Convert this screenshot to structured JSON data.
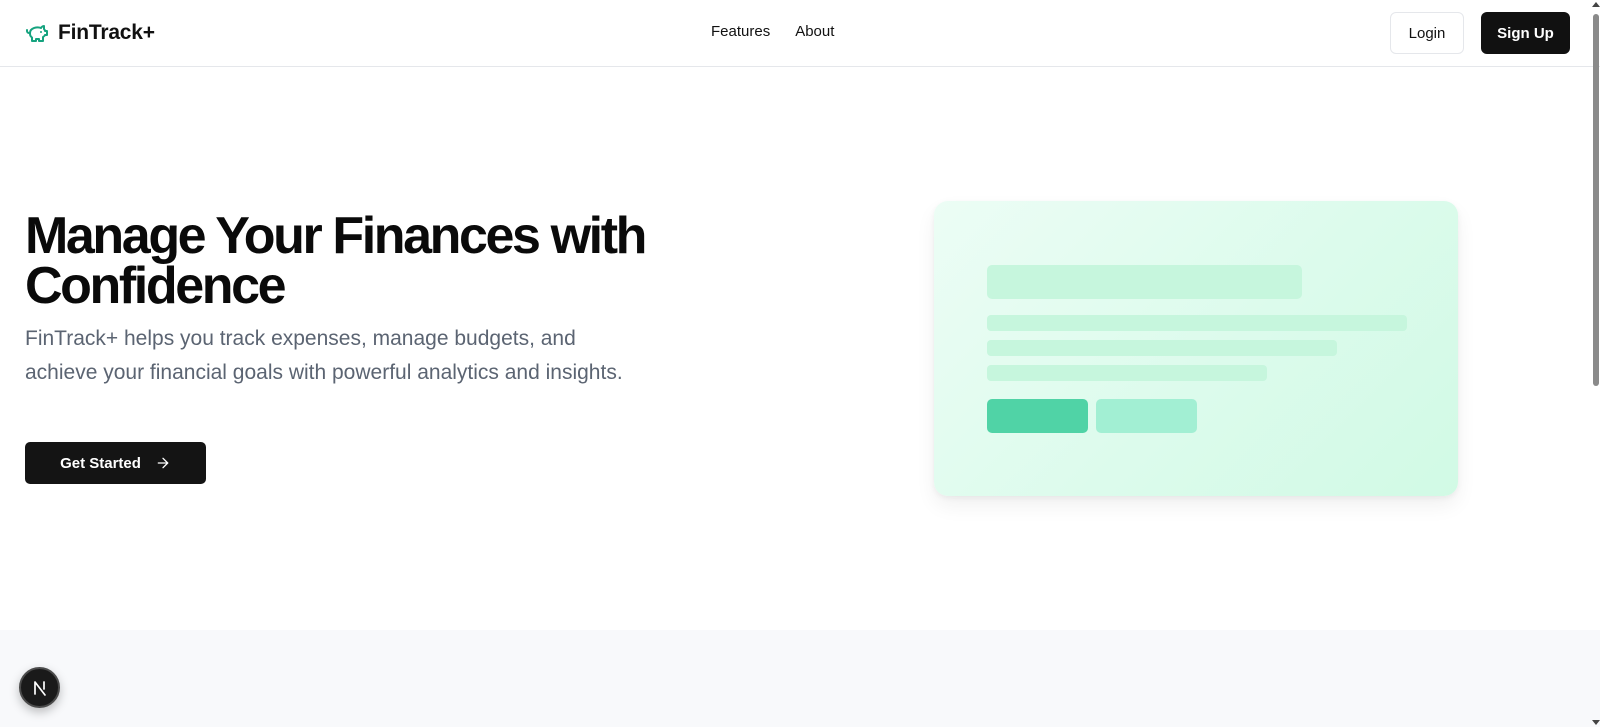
{
  "header": {
    "brand_name": "FinTrack+",
    "brand_icon": "piggy-bank-icon",
    "nav": [
      {
        "label": "Features"
      },
      {
        "label": "About"
      }
    ],
    "login_label": "Login",
    "signup_label": "Sign Up"
  },
  "hero": {
    "title": "Manage Your Finances with Confidence",
    "subtitle": "FinTrack+ helps you track expenses, manage budgets, and achieve your financial goals with powerful analytics and insights.",
    "cta_label": "Get Started",
    "cta_icon": "arrow-right-icon"
  },
  "dev_badge": {
    "icon": "nextjs-n-icon"
  },
  "colors": {
    "accent_green": "#16a37f",
    "dark_button": "#111111",
    "subtitle_gray": "#5b6472",
    "card_placeholder": "#c6f6dd",
    "card_button_primary": "#50d3a6",
    "card_button_secondary": "#a2efd3"
  }
}
